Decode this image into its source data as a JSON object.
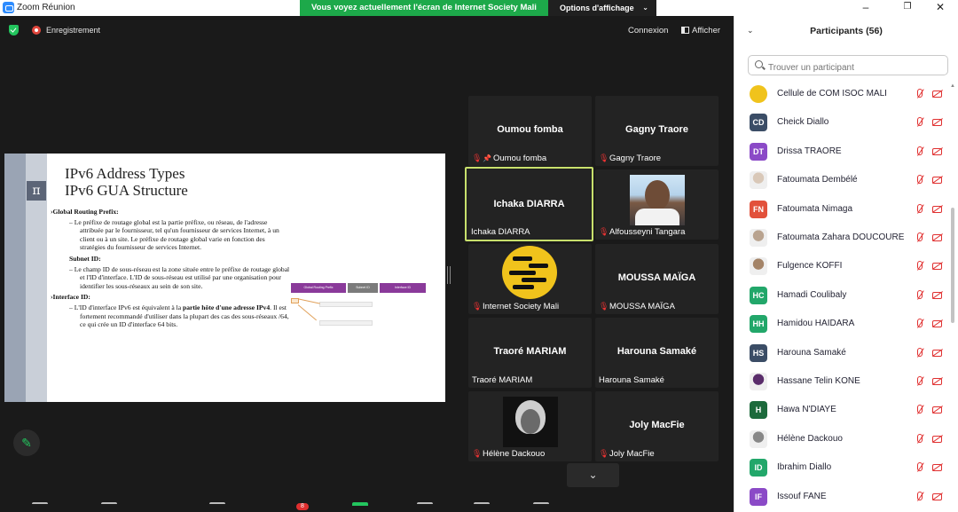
{
  "titlebar": {
    "title": "Zoom Réunion",
    "share_banner": "Vous voyez actuellement l'écran de Internet Society Mali",
    "view_options": "Options d'affichage",
    "minimize": "–",
    "maximize": "❐",
    "close": "✕"
  },
  "meeting": {
    "recording_label": "Enregistrement",
    "connexion_label": "Connexion",
    "afficher_label": "Afficher"
  },
  "slide": {
    "title_line1": "IPv6 Address Types",
    "title_line2": "IPv6 GUA Structure",
    "pi_symbol": "π",
    "h_global": "›Global Routing Prefix:",
    "p_global": "– Le préfixe de routage global est la partie préfixe, ou réseau, de l'adresse attribuée par le fournisseur, tel qu'un fournisseur de services Internet, à un client ou à un site. Le préfixe de routage global varie en fonction des stratégies du fournisseur de services Internet.",
    "h_subnet": "Subnet ID:",
    "p_subnet": "– Le champ ID de sous-réseau est la zone située entre le préfixe de routage global et l'ID d'interface. L'ID de sous-réseau est utilisé par une organisation pour identifier les sous-réseaux au sein de son site.",
    "h_interface": "›Interface ID:",
    "p_interface_a": "– L'ID d'interface IPv6 est équivalent à la ",
    "p_interface_bold": "partie hôte d'une adresse IPv4",
    "p_interface_b": ". Il est fortement recommandé d'utiliser dans la plupart des cas des sous-réseaux /64, ce qui crée un ID d'interface 64 bits.",
    "diagram": {
      "bar1": "Global Routing Prefix",
      "bar2": "Subnet ID",
      "bar3": "Interface ID"
    }
  },
  "tiles": [
    {
      "display": "Oumou fomba",
      "label": "Oumou fomba",
      "pinned": true
    },
    {
      "display": "Gagny Traore",
      "label": "Gagny Traore"
    },
    {
      "display": "Ichaka DIARRA",
      "label": "Ichaka DIARRA",
      "active": true
    },
    {
      "display": "",
      "label": "Alfousseyni Tangara"
    },
    {
      "display": "",
      "label": "Internet Society Mali"
    },
    {
      "display": "MOUSSA MAÏGA",
      "label": "MOUSSA MAÏGA"
    },
    {
      "display": "Traoré MARIAM",
      "label": "Traoré MARIAM"
    },
    {
      "display": "Harouna Samaké",
      "label": "Harouna Samaké"
    },
    {
      "display": "",
      "label": "Hélène Dackouo"
    },
    {
      "display": "Joly MacFie",
      "label": "Joly MacFie"
    }
  ],
  "toolbar_peek": {
    "participants_badge": "8",
    "count_hint": "56"
  },
  "panel": {
    "title": "Participants (56)",
    "search_placeholder": "Trouver un participant",
    "participants": [
      {
        "name": "Cellule de COM ISOC MALI",
        "initials": "",
        "color": "#3b3b3b",
        "photo": "emoji"
      },
      {
        "name": "Cheick Diallo",
        "initials": "CD",
        "color": "#3b4d66"
      },
      {
        "name": "Drissa TRAORE",
        "initials": "DT",
        "color": "#8b4ac7"
      },
      {
        "name": "Fatoumata Dembélé",
        "initials": "",
        "color": "#d9c8b8",
        "photo": "face"
      },
      {
        "name": "Fatoumata Nimaga",
        "initials": "FN",
        "color": "#e2513b"
      },
      {
        "name": "Fatoumata Zahara DOUCOURE",
        "initials": "",
        "color": "#b9a38f",
        "photo": "face"
      },
      {
        "name": "Fulgence KOFFI",
        "initials": "",
        "color": "#a48468",
        "photo": "face"
      },
      {
        "name": "Hamadi Coulibaly",
        "initials": "HC",
        "color": "#22a76a"
      },
      {
        "name": "Hamidou HAIDARA",
        "initials": "HH",
        "color": "#22a76a"
      },
      {
        "name": "Harouna Samaké",
        "initials": "HS",
        "color": "#3b4d66"
      },
      {
        "name": "Hassane Telin KONE",
        "initials": "",
        "color": "#5a2d6b",
        "photo": "face"
      },
      {
        "name": "Hawa N'DIAYE",
        "initials": "H",
        "color": "#1d6a3c"
      },
      {
        "name": "Hélène Dackouo",
        "initials": "",
        "color": "#888888",
        "photo": "face"
      },
      {
        "name": "Ibrahim Diallo",
        "initials": "ID",
        "color": "#22a76a"
      },
      {
        "name": "Issouf FANE",
        "initials": "IF",
        "color": "#8b4ac7"
      }
    ]
  },
  "colors": {
    "banner_green": "#1da94a",
    "active_speaker": "#c8e06c",
    "muted_red": "#e02f2f"
  }
}
